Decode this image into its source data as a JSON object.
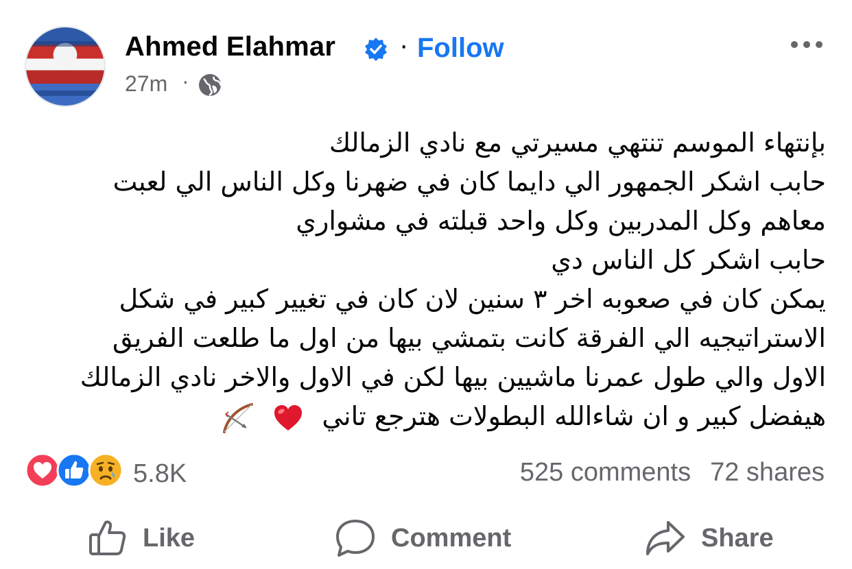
{
  "author": {
    "name": "Ahmed Elahmar",
    "follow_label": "Follow",
    "separator": "·",
    "timestamp": "27m",
    "privacy_icon": "globe-icon",
    "verified_icon": "verified-badge-icon"
  },
  "post": {
    "lines": [
      "بإنتهاء الموسم تنتهي مسيرتي مع نادي الزمالك",
      "حابب اشكر  الجمهور  الي دايما كان في ضهرنا وكل الناس الي لعبت",
      "معاهم وكل المدربين وكل واحد قبلته في مشواري",
      "حابب اشكر كل الناس دي",
      "يمكن كان في صعوبه اخر ٣ سنين لان كان في تغيير كبير في شكل",
      "الاستراتيجيه الي الفرقة كانت بتمشي بيها من اول ما طلعت الفريق",
      "الاول والي طول عمرنا ماشيين بيها لكن في الاول والاخر نادي الزمالك",
      "هيفضل كبير و ان شاءالله البطولات هترجع تاني"
    ],
    "trailing_emojis": [
      "red-heart",
      "bow-and-arrow"
    ]
  },
  "engagement": {
    "reaction_icons": [
      "love-icon",
      "like-icon",
      "sad-icon"
    ],
    "reaction_count": "5.8K",
    "comments": "525 comments",
    "shares": "72 shares"
  },
  "actions": {
    "like": "Like",
    "comment": "Comment",
    "share": "Share"
  },
  "colors": {
    "link_blue": "#1877f2",
    "secondary_text": "#65676b",
    "love_red": "#f33e58",
    "like_blue": "#1877f2",
    "sad_yellow": "#f7b125"
  }
}
